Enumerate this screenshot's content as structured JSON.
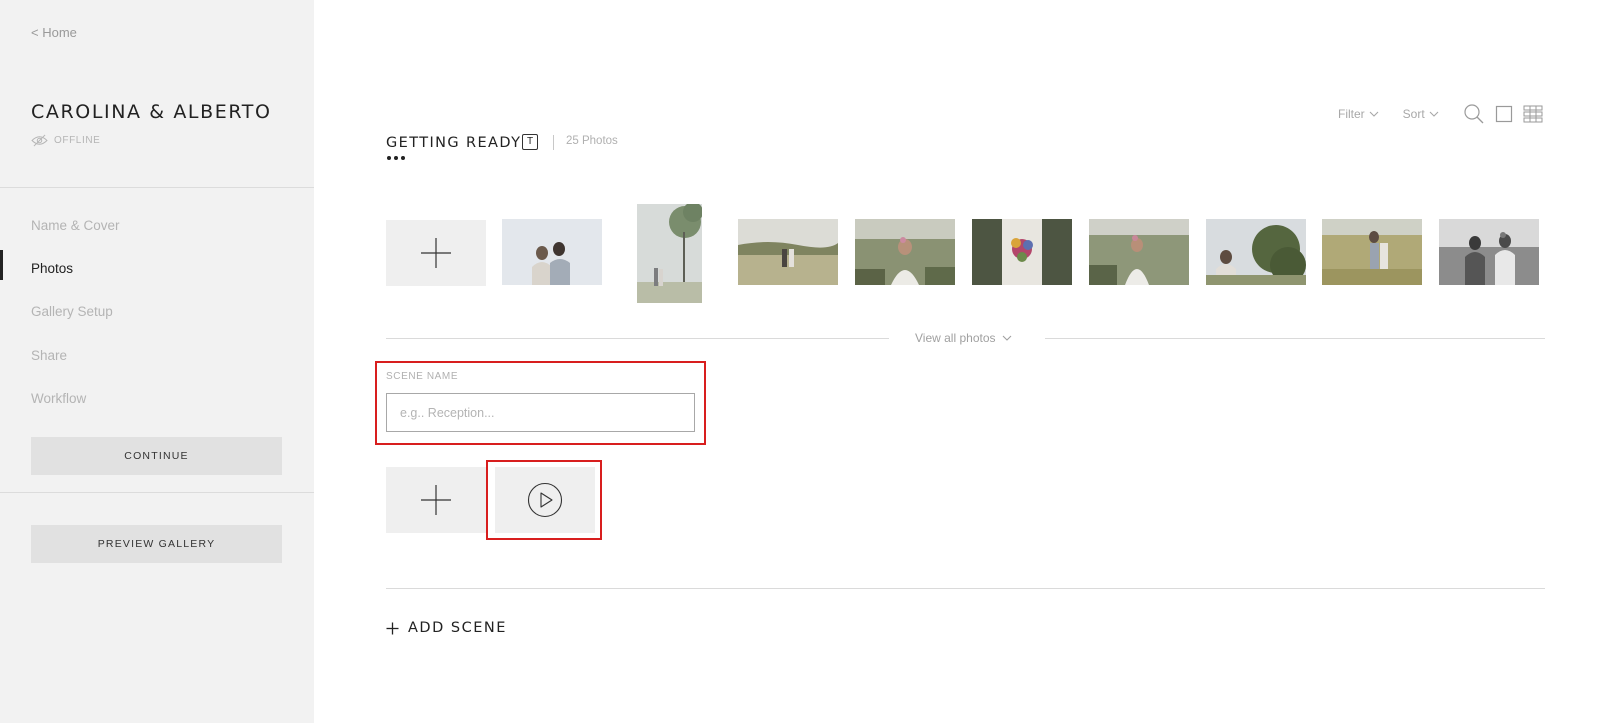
{
  "sidebar": {
    "home_link": "< Home",
    "gallery_name": "CAROLINA & ALBERTO",
    "status": "OFFLINE",
    "nav": [
      {
        "label": "Name & Cover"
      },
      {
        "label": "Photos"
      },
      {
        "label": "Gallery Setup"
      },
      {
        "label": "Share"
      },
      {
        "label": "Workflow"
      }
    ],
    "active_nav": "Photos",
    "continue_label": "CONTINUE",
    "preview_label": "PREVIEW GALLERY"
  },
  "toolbar": {
    "filter_label": "Filter",
    "sort_label": "Sort",
    "icons": [
      "search-icon",
      "single-view-icon",
      "grid-view-icon"
    ]
  },
  "scene": {
    "title": "GETTING READY",
    "badge": "T",
    "photo_count": "25 Photos",
    "view_all_label": "View all photos"
  },
  "new_scene": {
    "label": "SCENE NAME",
    "placeholder": "e.g.. Reception..."
  },
  "add_scene_label": "ADD SCENE",
  "colors": {
    "sidebar_bg": "#f2f2f2",
    "highlight": "#d81e1e",
    "active_text": "#222222",
    "muted_text": "#b4b4b4"
  }
}
